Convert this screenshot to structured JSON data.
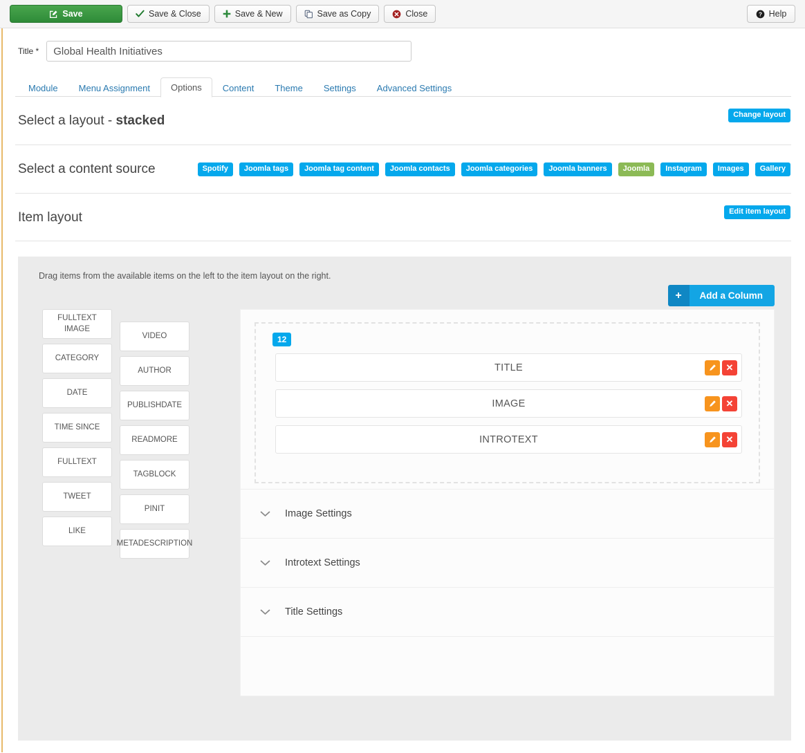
{
  "toolbar": {
    "buttons": [
      {
        "name": "save",
        "label": "Save",
        "icon": "edit-square-icon"
      },
      {
        "name": "save-close",
        "label": "Save & Close",
        "icon": "check-icon"
      },
      {
        "name": "save-new",
        "label": "Save & New",
        "icon": "plus-icon"
      },
      {
        "name": "save-copy",
        "label": "Save as Copy",
        "icon": "copy-icon"
      },
      {
        "name": "close",
        "label": "Close",
        "icon": "close-circle-icon"
      }
    ],
    "help_label": "Help",
    "help_icon": "question-circle-icon"
  },
  "form": {
    "title_label": "Title *",
    "title_value": "Global Health Initiatives",
    "title_placeholder": "Title"
  },
  "tabs": [
    {
      "label": "Module",
      "active": false
    },
    {
      "label": "Menu Assignment",
      "active": false
    },
    {
      "label": "Options",
      "active": true
    },
    {
      "label": "Content",
      "active": false
    },
    {
      "label": "Theme",
      "active": false
    },
    {
      "label": "Settings",
      "active": false
    },
    {
      "label": "Advanced Settings",
      "active": false
    }
  ],
  "layout_section": {
    "heading_prefix": "Select a layout - ",
    "heading_value": "stacked",
    "button_label": "Change layout"
  },
  "source_section": {
    "heading": "Select a content source",
    "sources": [
      {
        "label": "Spotify",
        "active": false
      },
      {
        "label": "Joomla tags",
        "active": false
      },
      {
        "label": "Joomla tag content",
        "active": false
      },
      {
        "label": "Joomla contacts",
        "active": false
      },
      {
        "label": "Joomla categories",
        "active": false
      },
      {
        "label": "Joomla banners",
        "active": false
      },
      {
        "label": "Joomla",
        "active": true
      },
      {
        "label": "Instagram",
        "active": false
      },
      {
        "label": "Images",
        "active": false
      },
      {
        "label": "Gallery",
        "active": false
      }
    ]
  },
  "item_layout_section": {
    "heading": "Item layout",
    "button_label": "Edit item layout"
  },
  "builder": {
    "drag_hint": "Drag items from the available items on the left to the item layout on the right.",
    "add_column_label": "Add a Column",
    "add_column_icon": "plus-icon",
    "available_left": [
      "FULLTEXT IMAGE",
      "CATEGORY",
      "DATE",
      "TIME SINCE",
      "FULLTEXT",
      "TWEET",
      "LIKE"
    ],
    "available_right": [
      "VIDEO",
      "AUTHOR",
      "PUBLISHDATE",
      "READMORE",
      "TAGBLOCK",
      "PINIT",
      "METADESCRIPTION"
    ],
    "column_size": "12",
    "rows": [
      {
        "label": "TITLE",
        "edit_icon": "pencil-icon",
        "delete_icon": "close-icon"
      },
      {
        "label": "IMAGE",
        "edit_icon": "pencil-icon",
        "delete_icon": "close-icon"
      },
      {
        "label": "INTROTEXT",
        "edit_icon": "pencil-icon",
        "delete_icon": "close-icon"
      }
    ],
    "accordions": [
      {
        "label": "Image Settings",
        "icon": "chevron-down-icon"
      },
      {
        "label": "Introtext Settings",
        "icon": "chevron-down-icon"
      },
      {
        "label": "Title Settings",
        "icon": "chevron-down-icon"
      }
    ]
  },
  "colors": {
    "save_green": "#2e8b38",
    "badge_blue": "#05a8ec",
    "badge_green": "#8cba56",
    "edit_orange": "#f7941e",
    "delete_red": "#f44336",
    "accent_left_rule": "#e8b96a",
    "panel_gray": "#ebebeb"
  }
}
